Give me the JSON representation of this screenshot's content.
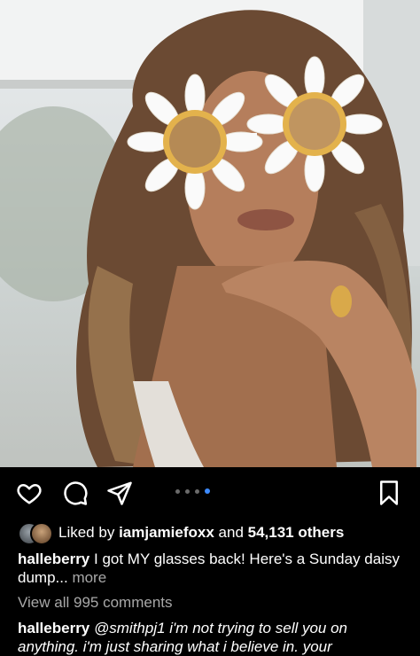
{
  "post": {
    "image_alt": "Woman wearing daisy-shaped sunglasses",
    "carousel": {
      "count": 4,
      "active_index": 3
    }
  },
  "likes": {
    "prefix": "Liked by",
    "user": "iamjamiefoxx",
    "conj": "and",
    "others": "54,131 others"
  },
  "caption": {
    "username": "halleberry",
    "text": "I got MY glasses back! Here's a Sunday daisy dump...",
    "more": "more"
  },
  "comments": {
    "view_all": "View all 995 comments"
  },
  "top_comment": {
    "username": "halleberry",
    "text": "@smithpj1 i'm not trying to sell you on anything. i'm just sharing what i believe in. your"
  },
  "icons": {
    "like": "heart-icon",
    "comment": "comment-icon",
    "share": "send-icon",
    "save": "bookmark-icon"
  },
  "colors": {
    "background": "#000000",
    "accent": "#3d8bff",
    "secondary_text": "#a8a8a8"
  }
}
